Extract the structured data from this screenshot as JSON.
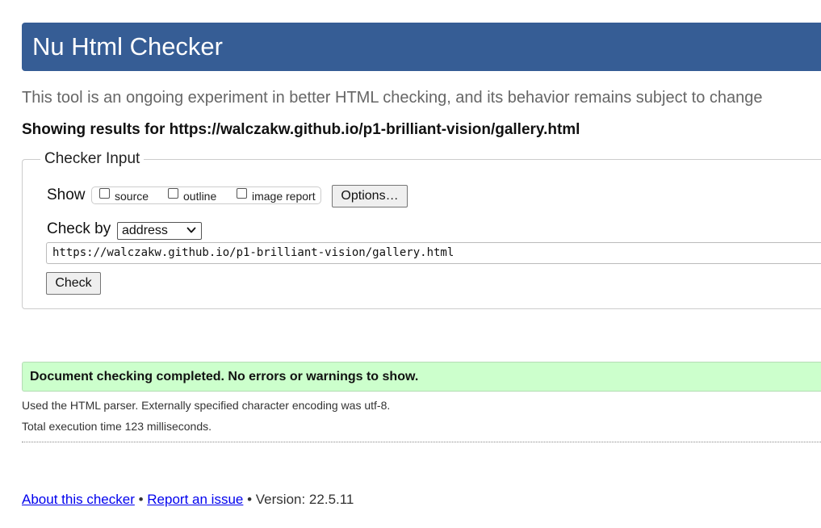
{
  "header": {
    "title": "Nu Html Checker"
  },
  "intro_text": "This tool is an ongoing experiment in better HTML checking, and its behavior remains subject to change",
  "results_heading": "Showing results for https://walczakw.github.io/p1-brilliant-vision/gallery.html",
  "checker_input": {
    "legend": "Checker Input",
    "show_label": "Show",
    "show_options": [
      {
        "label": "source",
        "checked": false
      },
      {
        "label": "outline",
        "checked": false
      },
      {
        "label": "image report",
        "checked": false
      }
    ],
    "options_button": "Options…",
    "check_by_label": "Check by",
    "check_by_selected": "address",
    "url_value": "https://walczakw.github.io/p1-brilliant-vision/gallery.html",
    "check_button": "Check"
  },
  "result": {
    "message": "Document checking completed. No errors or warnings to show.",
    "parser_info": "Used the HTML parser. Externally specified character encoding was utf-8.",
    "timing_info": "Total execution time 123 milliseconds."
  },
  "footer": {
    "about_link": "About this checker",
    "separator": "•",
    "report_link": "Report an issue",
    "version_text": "Version: 22.5.11"
  },
  "colors": {
    "header_bg": "#365d95",
    "success_bg": "#ccffcc",
    "link": "#0000ee"
  }
}
